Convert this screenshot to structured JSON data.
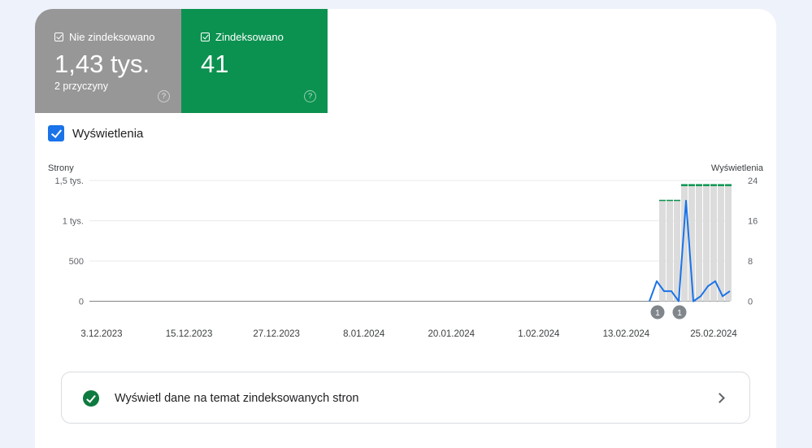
{
  "tiles": {
    "not_indexed": {
      "label": "Nie zindeksowano",
      "value": "1,43 tys.",
      "sub": "2 przyczyny",
      "help": "?"
    },
    "indexed": {
      "label": "Zindeksowano",
      "value": "41",
      "help": "?"
    }
  },
  "metric_toggle": {
    "label": "Wyświetlenia",
    "checked": true
  },
  "link_row": {
    "label": "Wyświetl dane na temat zindeksowanych stron"
  },
  "colors": {
    "indexed": "#0c9250",
    "not_indexed": "#979797",
    "line": "#1a73e8",
    "bar": "#dcdcdc"
  },
  "chart_data": {
    "type": "bar+line",
    "left_axis_title": "Strony",
    "right_axis_title": "Wyświetlenia",
    "left_ticks": [
      "0",
      "500",
      "1 tys.",
      "1,5 tys."
    ],
    "left_tick_values": [
      0,
      500,
      1000,
      1500
    ],
    "right_ticks": [
      "0",
      "8",
      "16",
      "24"
    ],
    "right_tick_values": [
      0,
      8,
      16,
      24
    ],
    "x_tick_labels": [
      "3.12.2023",
      "15.12.2023",
      "27.12.2023",
      "8.01.2024",
      "20.01.2024",
      "1.02.2024",
      "13.02.2024",
      "25.02.2024"
    ],
    "bars_not_indexed": [
      1250,
      1250,
      1250,
      1430,
      1430,
      1430,
      1430,
      1430,
      1430,
      1430
    ],
    "bars_indexed": [
      10,
      10,
      10,
      25,
      25,
      25,
      25,
      25,
      25,
      25
    ],
    "line_views": [
      0,
      4,
      2,
      2,
      0,
      20,
      0,
      1,
      3,
      4,
      1,
      2
    ],
    "annotations": [
      {
        "label": "1",
        "point_index": 1
      },
      {
        "label": "1",
        "point_index": 4
      }
    ]
  }
}
